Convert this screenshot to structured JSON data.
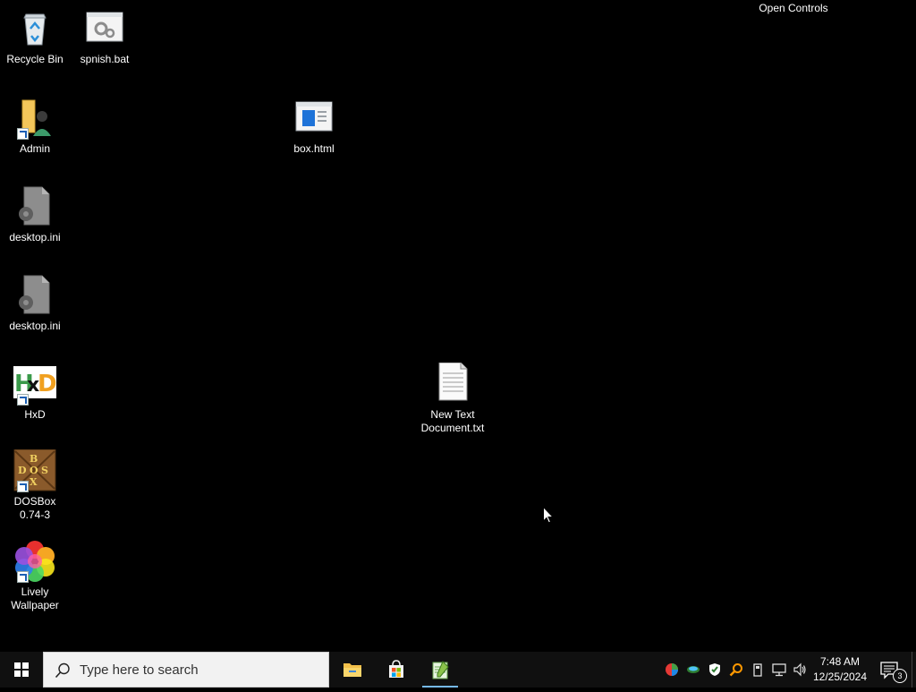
{
  "desktop": {
    "background_color": "#000000",
    "open_controls_label": "Open Controls",
    "icons": [
      {
        "label": "Recycle Bin",
        "icon": "recycle-bin-icon",
        "shortcut": false
      },
      {
        "label": "spnish.bat",
        "icon": "batch-file-icon",
        "shortcut": false
      },
      {
        "label": "Admin",
        "icon": "user-folder-icon",
        "shortcut": true
      },
      {
        "label": "box.html",
        "icon": "html-file-icon",
        "shortcut": false
      },
      {
        "label": "desktop.ini",
        "icon": "settings-file-icon",
        "shortcut": false
      },
      {
        "label": "desktop.ini",
        "icon": "settings-file-icon",
        "shortcut": false
      },
      {
        "label": "HxD",
        "icon": "hxd-icon",
        "shortcut": true
      },
      {
        "label": "New Text\nDocument.txt",
        "icon": "text-document-icon",
        "shortcut": false
      },
      {
        "label": "DOSBox\n0.74-3",
        "icon": "dosbox-icon",
        "shortcut": true
      },
      {
        "label": "Lively\nWallpaper",
        "icon": "lively-wallpaper-icon",
        "shortcut": true
      }
    ]
  },
  "taskbar": {
    "start_icon": "windows-start-icon",
    "search_placeholder": "Type here to search",
    "pinned_apps": [
      {
        "name": "File Explorer",
        "icon": "file-explorer-icon",
        "active": false
      },
      {
        "name": "Microsoft Store",
        "icon": "microsoft-store-icon",
        "active": false
      },
      {
        "name": "Notepad++",
        "icon": "notepad-plus-plus-icon",
        "active": true
      }
    ],
    "tray_icons": [
      "color-app-icon",
      "network-drive-icon",
      "security-shield-icon",
      "search-tool-icon",
      "usb-device-icon",
      "network-icon",
      "volume-icon"
    ],
    "clock": {
      "time": "7:48 AM",
      "date": "12/25/2024"
    },
    "notification_count": "3"
  }
}
